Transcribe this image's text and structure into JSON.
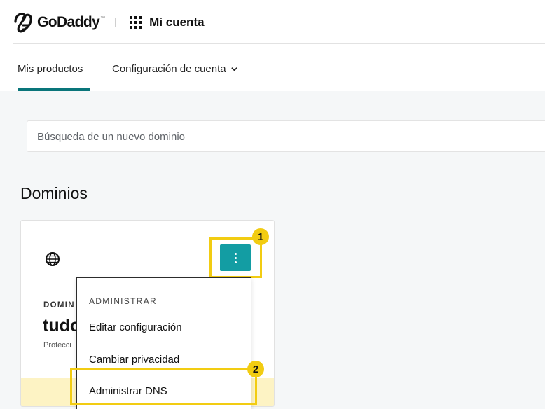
{
  "header": {
    "logo_text": "GoDaddy",
    "logo_tm": "™",
    "app_title": "Mi cuenta"
  },
  "tabs": [
    {
      "label": "Mis productos",
      "active": true
    },
    {
      "label": "Configuración de cuenta",
      "active": false
    }
  ],
  "search": {
    "placeholder": "Búsqueda de un nuevo dominio"
  },
  "section": {
    "title": "Dominios"
  },
  "domain_card": {
    "label": "DOMIN",
    "domain": "tudo",
    "subtitle": "Protecci"
  },
  "menu": {
    "heading": "ADMINISTRAR",
    "items": [
      "Editar configuración",
      "Cambiar privacidad",
      "Administrar DNS"
    ]
  },
  "annotations": {
    "step1": "1",
    "step2": "2",
    "highlight_color": "#f2cc12"
  },
  "colors": {
    "accent": "#09757a",
    "button": "#139da3"
  },
  "icons": [
    "godaddy-logo-icon",
    "apps-grid-icon",
    "chevron-down-icon",
    "globe-icon",
    "more-vertical-icon"
  ]
}
